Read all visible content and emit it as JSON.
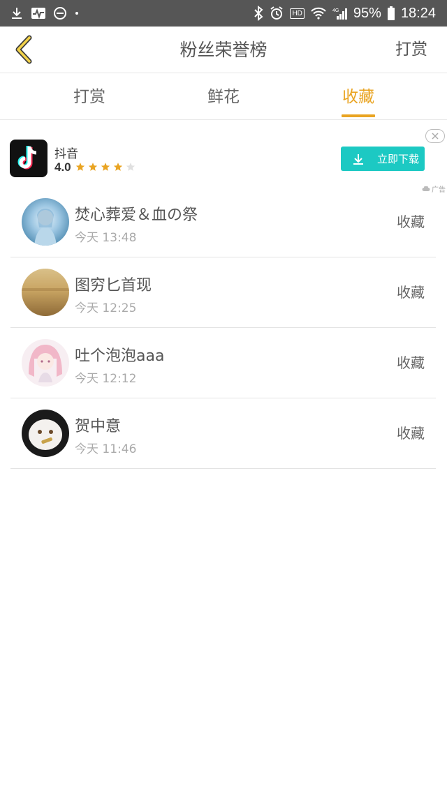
{
  "status_bar": {
    "battery": "95%",
    "time": "18:24",
    "hd": "HD",
    "network": "4G"
  },
  "header": {
    "title": "粉丝荣誉榜",
    "action": "打赏"
  },
  "tabs": [
    {
      "label": "打赏",
      "active": false
    },
    {
      "label": "鲜花",
      "active": false
    },
    {
      "label": "收藏",
      "active": true
    }
  ],
  "ad": {
    "app_name": "抖音",
    "rating": "4.0",
    "stars_filled": 4,
    "stars_total": 5,
    "download_label": "立即下载",
    "tag": "广告"
  },
  "records": [
    {
      "name": "焚心葬爱＆血の祭",
      "time": "今天 13:48",
      "type": "收藏"
    },
    {
      "name": "图穷匕首现",
      "time": "今天 12:25",
      "type": "收藏"
    },
    {
      "name": "吐个泡泡aaa",
      "time": "今天 12:12",
      "type": "收藏"
    },
    {
      "name": "贺中意",
      "time": "今天 11:46",
      "type": "收藏"
    }
  ],
  "colors": {
    "accent": "#e9a422",
    "download_button": "#1cc9c3",
    "status_bar": "#565656"
  }
}
